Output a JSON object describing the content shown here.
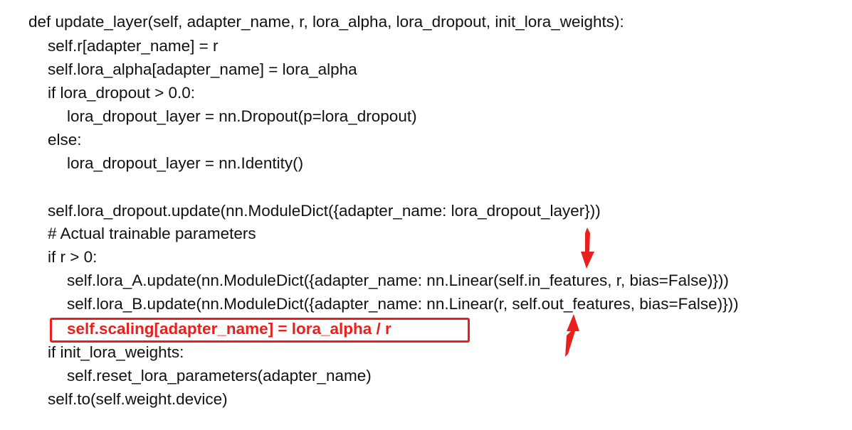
{
  "code": {
    "lines": [
      "def update_layer(self, adapter_name, r, lora_alpha, lora_dropout, init_lora_weights):",
      "self.r[adapter_name] = r",
      "self.lora_alpha[adapter_name] = lora_alpha",
      "if lora_dropout > 0.0:",
      "lora_dropout_layer = nn.Dropout(p=lora_dropout)",
      "else:",
      "lora_dropout_layer = nn.Identity()",
      "",
      "self.lora_dropout.update(nn.ModuleDict({adapter_name: lora_dropout_layer}))",
      "# Actual trainable parameters",
      "if r > 0:",
      "self.lora_A.update(nn.ModuleDict({adapter_name: nn.Linear(self.in_features, r, bias=False)}))",
      "self.lora_B.update(nn.ModuleDict({adapter_name: nn.Linear(r, self.out_features, bias=False)}))",
      "self.scaling[adapter_name] = lora_alpha / r",
      "if init_lora_weights:",
      "self.reset_lora_parameters(adapter_name)",
      "self.to(self.weight.device)"
    ]
  },
  "annotations": {
    "highlight_color": "#e8201d",
    "highlighted_line_index": 13,
    "arrow_icons": [
      "arrow-down-icon",
      "arrow-up-icon"
    ]
  }
}
